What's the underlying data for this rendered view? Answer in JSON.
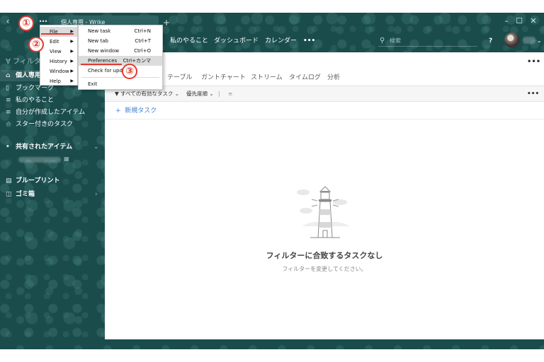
{
  "titlebar": {
    "back_icon": "chevron-left-icon",
    "tab_title": "個人専用 - Wrike",
    "new_tab_label": "+",
    "window_controls": [
      "–",
      "☐",
      "✕"
    ]
  },
  "nav": {
    "items": [
      "私のやること",
      "ダッシュボード",
      "カレンダー",
      "•••"
    ],
    "search_placeholder": "検索",
    "help_label": "?",
    "caret": "⌄"
  },
  "sidebar": {
    "filter_label": "フィルタ",
    "items": [
      {
        "icon": "house-icon",
        "label": "個人専用"
      },
      {
        "icon": "bookmark-icon",
        "label": "ブックマーク"
      },
      {
        "icon": "list-icon",
        "label": "私のやること"
      },
      {
        "icon": "list-icon",
        "label": "自分が作成したアイテム"
      },
      {
        "icon": "star-icon",
        "label": "スター付きのタスク"
      }
    ],
    "shared_label": "共有されたアイテム",
    "blueprint_label": "ブループリント",
    "trash_label": "ゴミ箱"
  },
  "main": {
    "more_label": "•••",
    "view_tabs": [
      "テーブル",
      "ガントチャート",
      "ストリーム",
      "タイムログ",
      "分析"
    ],
    "filter_task": "すべての有効なタスク",
    "sort_label": "優先度順",
    "new_task_label": "新規タスク",
    "new_task_plus": "+",
    "empty_title": "フィルターに合致するタスクなし",
    "empty_subtitle": "フィルターを変更してください。"
  },
  "app_menu": {
    "items": [
      "File",
      "Edit",
      "View",
      "History",
      "Window",
      "Help"
    ],
    "arrow": "▶"
  },
  "file_menu": {
    "items": [
      {
        "label": "New task",
        "shortcut": "Ctrl+N"
      },
      {
        "label": "New tab",
        "shortcut": "Ctrl+T"
      },
      {
        "label": "New window",
        "shortcut": "Ctrl+O"
      },
      {
        "label": "Preferences",
        "shortcut": "Ctrl+カンマ"
      },
      {
        "label": "Check for updates",
        "shortcut": ""
      },
      {
        "label": "Exit",
        "shortcut": ""
      }
    ]
  },
  "annotations": [
    "①",
    "②",
    "③"
  ],
  "colors": {
    "background": "#1a4c4c",
    "accent_blue": "#3f7ed1",
    "annotation_red": "#e03a30",
    "menu_highlight": "#dcdcdc"
  }
}
